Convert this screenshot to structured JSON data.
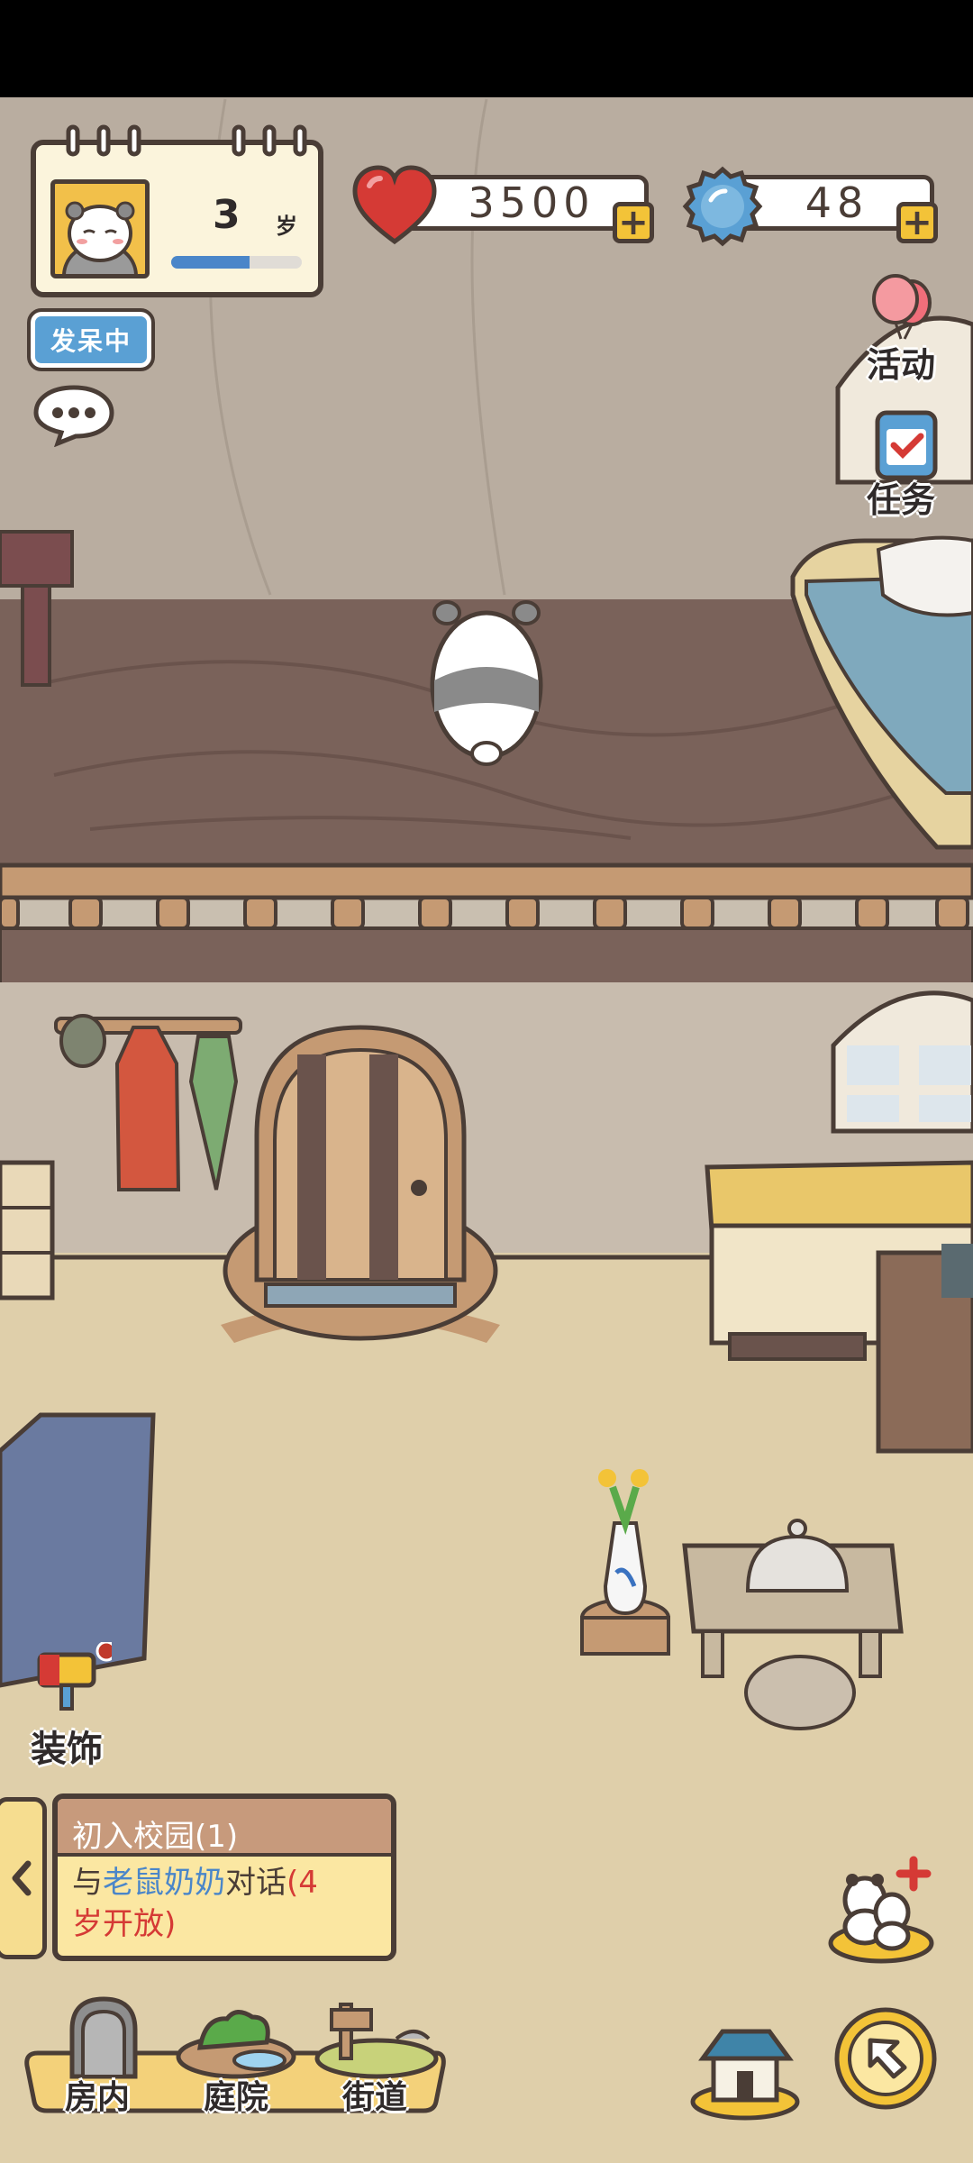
{
  "profile": {
    "age": "3",
    "age_unit": "岁",
    "age_progress": 0.6,
    "status_badge": "发呆中"
  },
  "currencies": {
    "hearts": "3500",
    "gems": "48"
  },
  "side_menu": {
    "activity_label": "活动",
    "tasks_label": "任务"
  },
  "decorate": {
    "label": "装饰"
  },
  "quest": {
    "title": "初入校园(1)",
    "line_prefix": "与",
    "npc_name": "老鼠奶奶",
    "line_action": "对话",
    "unlock_note_a": "(4",
    "unlock_note_b": "岁开放)"
  },
  "nav": {
    "tab_indoor": "房内",
    "tab_courtyard": "庭院",
    "tab_street": "街道"
  },
  "colors": {
    "accent_blue": "#4a86c9",
    "highlight_red": "#d53a35",
    "badge_blue": "#5aa0d4"
  }
}
